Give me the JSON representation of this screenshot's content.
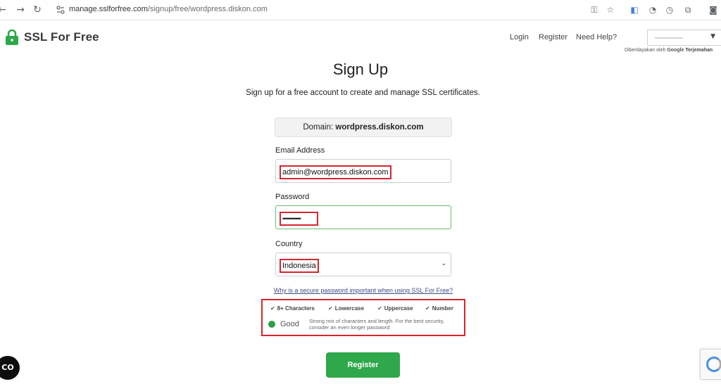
{
  "browser": {
    "url_host": "manage.sslforfree.com",
    "url_path": "/signup/free/wordpress.diskon.com"
  },
  "header": {
    "logo_text": "SSL For Free",
    "nav": {
      "login": "Login",
      "register": "Register",
      "help": "Need Help?"
    },
    "powered_by": "Diberdayakan oleh",
    "powered_google": "Google",
    "powered_translate": "Terjemahan"
  },
  "main": {
    "title": "Sign Up",
    "subtitle": "Sign up for a free account to create and manage SSL certificates.",
    "domain_label": "Domain:",
    "domain_value": "wordpress.diskon.com",
    "email_label": "Email Address",
    "email_value": "admin@wordpress.diskon.com",
    "password_label": "Password",
    "password_value": "••••••••••••",
    "country_label": "Country",
    "country_value": "Indonesia",
    "why_link": "Why is a secure password important when using SSL For Free?",
    "requirements": [
      "8+ Characters",
      "Lowercase",
      "Uppercase",
      "Number"
    ],
    "strength_label": "Good",
    "strength_desc": "Strong mix of characters and length. For the best security, consider an even longer password",
    "register_button": "Register"
  },
  "floating": {
    "co_label": "CO"
  },
  "colors": {
    "accent_green": "#2ea84a",
    "highlight_red": "#d6262d",
    "logo_green": "#2ea84a"
  }
}
